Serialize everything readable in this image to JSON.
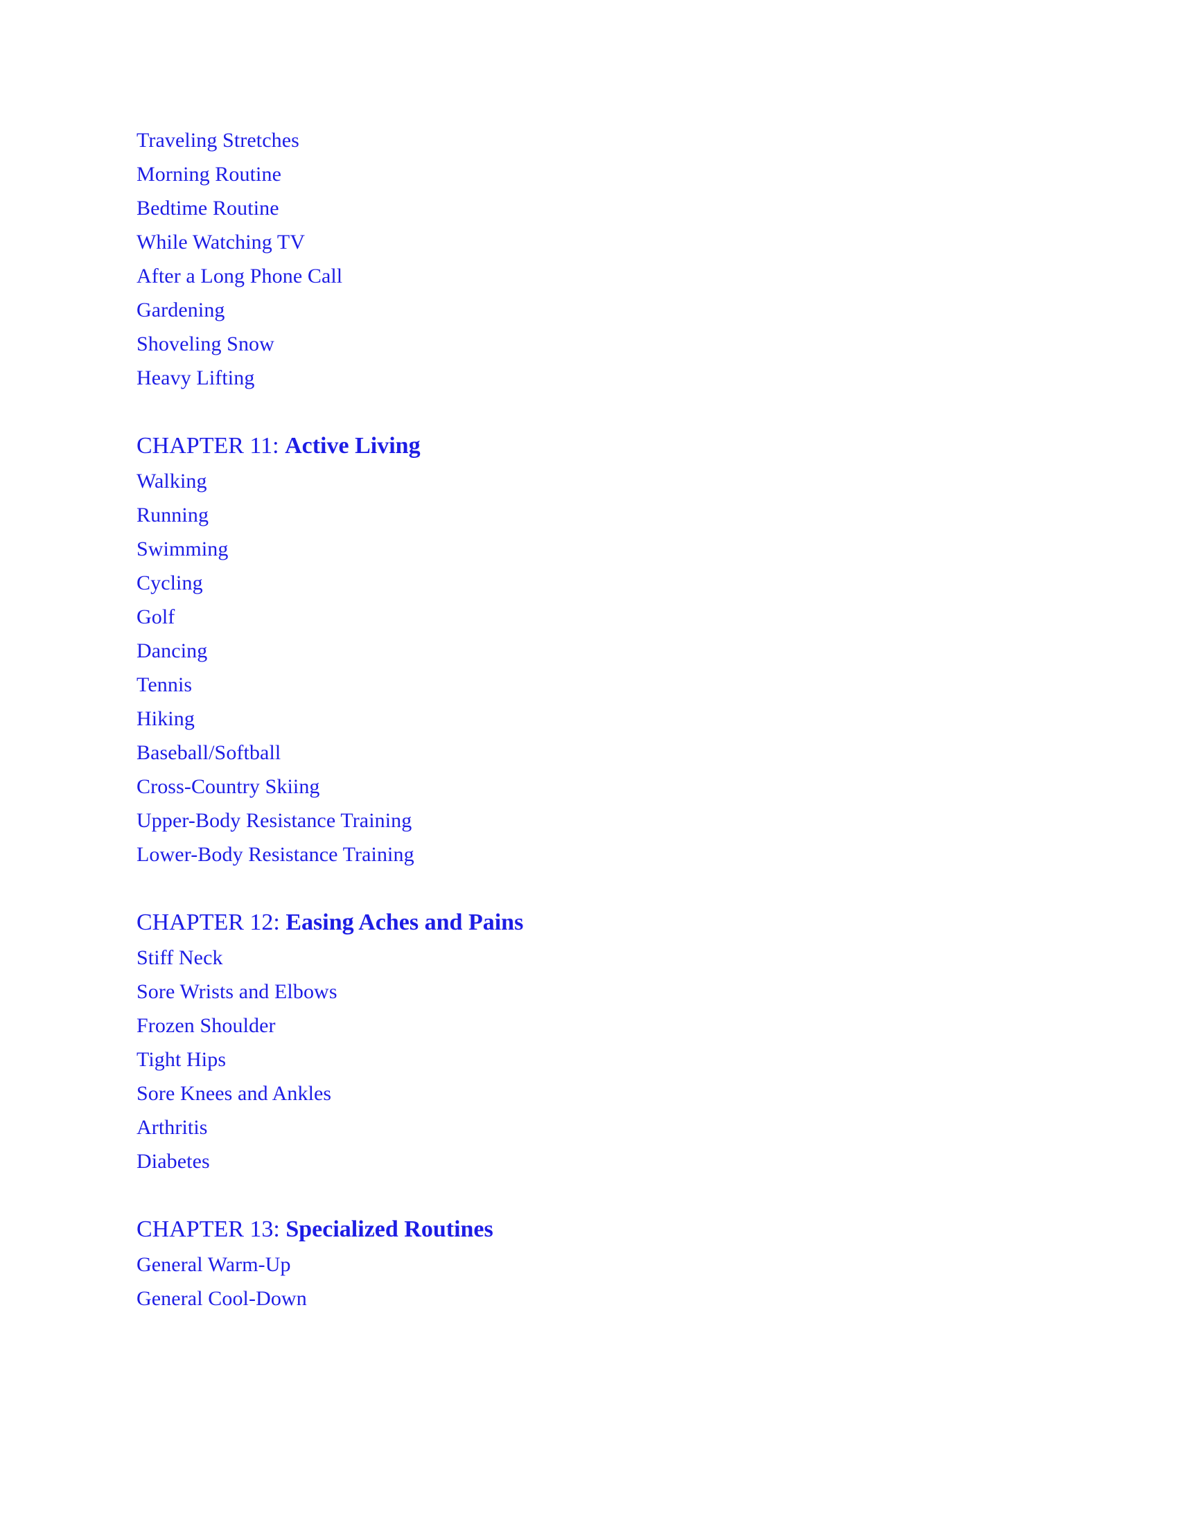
{
  "document": {
    "type": "table-of-contents",
    "text_color": "#1d1de4",
    "background_color": "#ffffff"
  },
  "continued_entries": [
    {
      "label": "Traveling Stretches"
    },
    {
      "label": "Morning Routine"
    },
    {
      "label": "Bedtime Routine"
    },
    {
      "label": "While Watching TV"
    },
    {
      "label": "After a Long Phone Call"
    },
    {
      "label": "Gardening"
    },
    {
      "label": "Shoveling Snow"
    },
    {
      "label": "Heavy Lifting"
    }
  ],
  "chapters": [
    {
      "number_label": "CHAPTER 11: ",
      "title": "Active Living",
      "entries": [
        {
          "label": "Walking"
        },
        {
          "label": "Running"
        },
        {
          "label": "Swimming"
        },
        {
          "label": "Cycling"
        },
        {
          "label": "Golf"
        },
        {
          "label": "Dancing"
        },
        {
          "label": "Tennis"
        },
        {
          "label": "Hiking"
        },
        {
          "label": "Baseball/Softball"
        },
        {
          "label": "Cross-Country Skiing"
        },
        {
          "label": "Upper-Body Resistance Training"
        },
        {
          "label": "Lower-Body Resistance Training"
        }
      ]
    },
    {
      "number_label": "CHAPTER 12: ",
      "title": "Easing Aches and Pains",
      "entries": [
        {
          "label": "Stiff Neck"
        },
        {
          "label": "Sore Wrists and Elbows"
        },
        {
          "label": "Frozen Shoulder"
        },
        {
          "label": "Tight Hips"
        },
        {
          "label": "Sore Knees and Ankles"
        },
        {
          "label": "Arthritis"
        },
        {
          "label": "Diabetes"
        }
      ]
    },
    {
      "number_label": "CHAPTER 13: ",
      "title": "Specialized Routines",
      "entries": [
        {
          "label": "General Warm-Up"
        },
        {
          "label": "General Cool-Down"
        }
      ]
    }
  ]
}
